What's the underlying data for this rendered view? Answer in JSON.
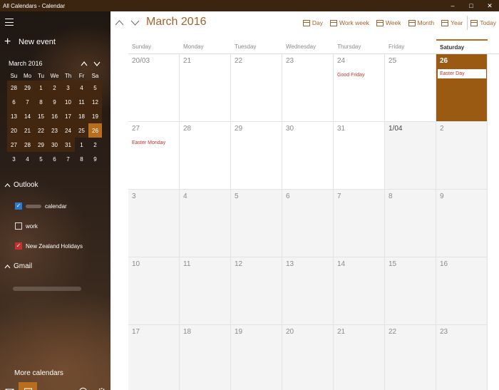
{
  "window": {
    "title": "All Calendars - Calendar",
    "minimize": "–",
    "maximize": "□",
    "close": "✕"
  },
  "sidebar": {
    "new_event_label": "New event",
    "mini_calendar": {
      "title": "March 2016",
      "weekdays": [
        "Su",
        "Mo",
        "Tu",
        "We",
        "Th",
        "Fr",
        "Sa"
      ],
      "weeks": [
        [
          "28",
          "29",
          "1",
          "2",
          "3",
          "4",
          "5"
        ],
        [
          "6",
          "7",
          "8",
          "9",
          "10",
          "11",
          "12"
        ],
        [
          "13",
          "14",
          "15",
          "16",
          "17",
          "18",
          "19"
        ],
        [
          "20",
          "21",
          "22",
          "23",
          "24",
          "25",
          "26"
        ],
        [
          "27",
          "28",
          "29",
          "30",
          "31",
          "1",
          "2"
        ],
        [
          "3",
          "4",
          "5",
          "6",
          "7",
          "8",
          "9"
        ]
      ],
      "selected_day": "26"
    },
    "outlook": {
      "label": "Outlook",
      "calendars": [
        {
          "label": "calendar",
          "checked": true,
          "color": "#2b7bd1"
        },
        {
          "label": "work",
          "checked": false,
          "color": "#ffffff"
        },
        {
          "label": "New Zealand Holidays",
          "checked": true,
          "color": "#c8302d"
        }
      ]
    },
    "gmail": {
      "label": "Gmail"
    },
    "more_calendars_label": "More calendars",
    "bottom_icons": [
      "mail-icon",
      "calendar-icon",
      "smiley-icon",
      "gear-icon"
    ]
  },
  "main": {
    "month_title": "March 2016",
    "views": {
      "day": "Day",
      "work_week": "Work week",
      "week": "Week",
      "month": "Month",
      "year": "Year",
      "today": "Today"
    },
    "day_headers": [
      "Sunday",
      "Monday",
      "Tuesday",
      "Wednesday",
      "Thursday",
      "Friday",
      "Saturday"
    ],
    "weeks": [
      [
        "20/03",
        "21",
        "22",
        "23",
        "24",
        "25",
        "26"
      ],
      [
        "27",
        "28",
        "29",
        "30",
        "31",
        "1/04",
        "2"
      ],
      [
        "3",
        "4",
        "5",
        "6",
        "7",
        "8",
        "9"
      ],
      [
        "10",
        "11",
        "12",
        "13",
        "14",
        "15",
        "16"
      ],
      [
        "17",
        "18",
        "19",
        "20",
        "21",
        "22",
        "23"
      ]
    ],
    "events": {
      "good_friday": "Good Friday",
      "easter_day": "Easter Day",
      "easter_monday": "Easter Monday"
    },
    "accent_color": "#b86e1d",
    "event_color": "#c8302d"
  }
}
